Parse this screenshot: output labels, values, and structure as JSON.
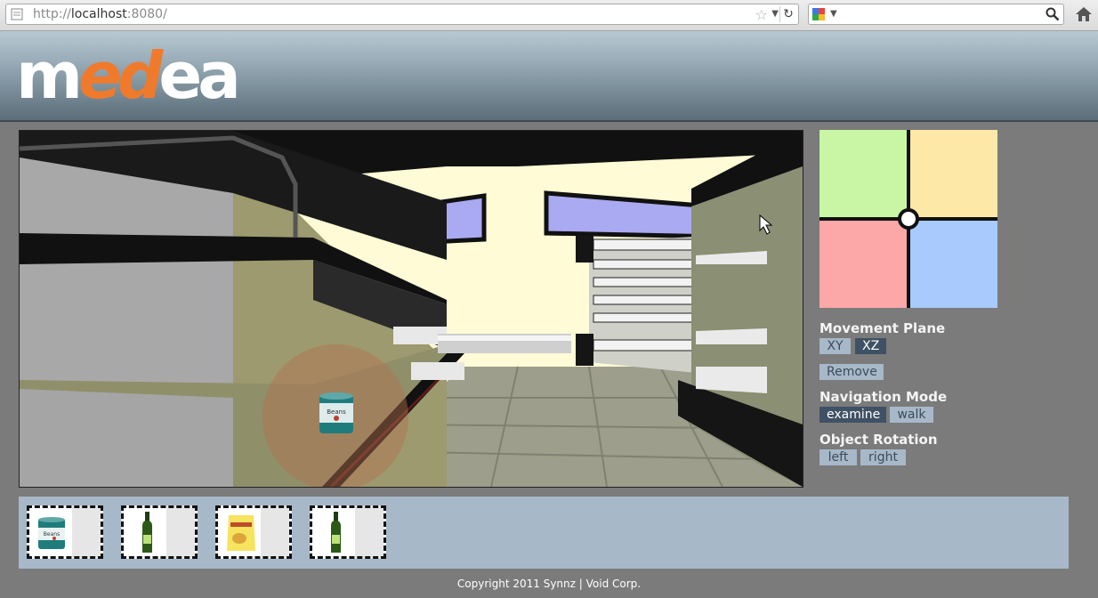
{
  "browser": {
    "url_prefix": "http://",
    "url_host": "localhost",
    "url_rest": ":8080/",
    "search_placeholder": ""
  },
  "header": {
    "logo_part1": "m",
    "logo_part2": "ed",
    "logo_part3": "ea"
  },
  "viewport": {
    "scene_label": "Beans"
  },
  "controller": {
    "quadrant_colors": [
      "#c8f6a4",
      "#fde8a8",
      "#fca8a8",
      "#a8cafc"
    ]
  },
  "panel": {
    "movement_plane": {
      "title": "Movement Plane",
      "options": [
        "XY",
        "XZ"
      ],
      "selected": "XZ"
    },
    "remove_label": "Remove",
    "navigation_mode": {
      "title": "Navigation Mode",
      "options": [
        "examine",
        "walk"
      ],
      "selected": "examine"
    },
    "object_rotation": {
      "title": "Object Rotation",
      "options": [
        "left",
        "right"
      ]
    }
  },
  "inventory": {
    "items": [
      {
        "icon": "beans-can-icon",
        "label": "Beans"
      },
      {
        "icon": "green-bottle-icon"
      },
      {
        "icon": "chips-bag-icon"
      },
      {
        "icon": "green-bottle-icon"
      }
    ]
  },
  "footer": {
    "copyright": "Copyright 2011 Synnz | Void Corp."
  }
}
